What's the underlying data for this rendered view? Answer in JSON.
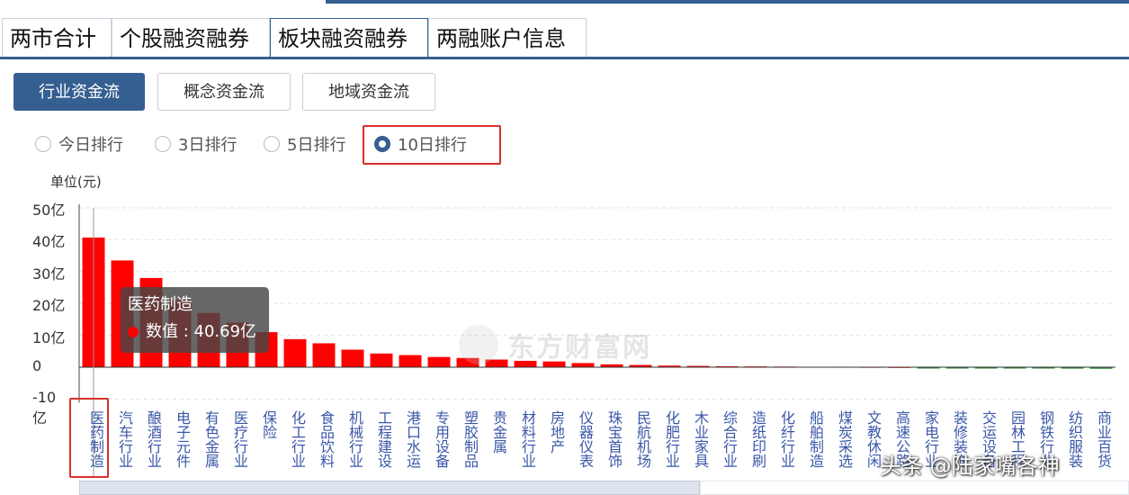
{
  "tabs": [
    {
      "label": "两市合计",
      "active": false
    },
    {
      "label": "个股融资融券",
      "active": false
    },
    {
      "label": "板块融资融券",
      "active": true
    },
    {
      "label": "两融账户信息",
      "active": false
    }
  ],
  "buttons": [
    {
      "label": "行业资金流",
      "active": true
    },
    {
      "label": "概念资金流",
      "active": false
    },
    {
      "label": "地域资金流",
      "active": false
    }
  ],
  "radios": [
    {
      "label": "今日排行",
      "checked": false
    },
    {
      "label": "3日排行",
      "checked": false
    },
    {
      "label": "5日排行",
      "checked": false
    },
    {
      "label": "10日排行",
      "checked": true
    }
  ],
  "chart_data": {
    "type": "bar",
    "ylabel": "单位(元)",
    "yticks": [
      "50亿",
      "40亿",
      "30亿",
      "20亿",
      "10亿",
      "0",
      "-10亿"
    ],
    "ylim": [
      -10,
      50
    ],
    "unit": "亿",
    "bar_color": "#ff0000",
    "negative_color": "#2e8b3a",
    "grid": true,
    "categories": [
      "医药制造",
      "汽车行业",
      "酿酒行业",
      "电子元件",
      "有色金属",
      "医疗行业",
      "保险",
      "化工行业",
      "食品饮料",
      "机械行业",
      "工程建设",
      "港口水运",
      "专用设备",
      "塑胶制品",
      "贵金属",
      "材料行业",
      "房地产",
      "仪器仪表",
      "珠宝首饰",
      "民航机场",
      "化肥行业",
      "木业家具",
      "综合行业",
      "造纸印刷",
      "化纤行业",
      "船舶制造",
      "煤炭采选",
      "文教休闲",
      "高速公路",
      "家电行业",
      "装修装饰",
      "交运设备",
      "园林工程",
      "钢铁行业",
      "纺织服装",
      "商业百货"
    ],
    "values": [
      40.69,
      33.5,
      28.0,
      21.0,
      17.0,
      14.0,
      11.0,
      8.8,
      7.5,
      5.5,
      4.3,
      3.8,
      3.2,
      2.9,
      2.4,
      2.0,
      1.8,
      1.3,
      0.9,
      0.7,
      0.5,
      0.4,
      0.3,
      0.25,
      0.2,
      0.1,
      0.08,
      0.05,
      0.0,
      -0.05,
      -0.1,
      -0.25,
      -0.35,
      -0.4,
      -0.45,
      -0.5
    ]
  },
  "tooltip": {
    "title": "医药制造",
    "label": "数值",
    "value": "40.69亿"
  },
  "watermark": "东方财富网",
  "credit": "头条 @陆家嘴各神"
}
